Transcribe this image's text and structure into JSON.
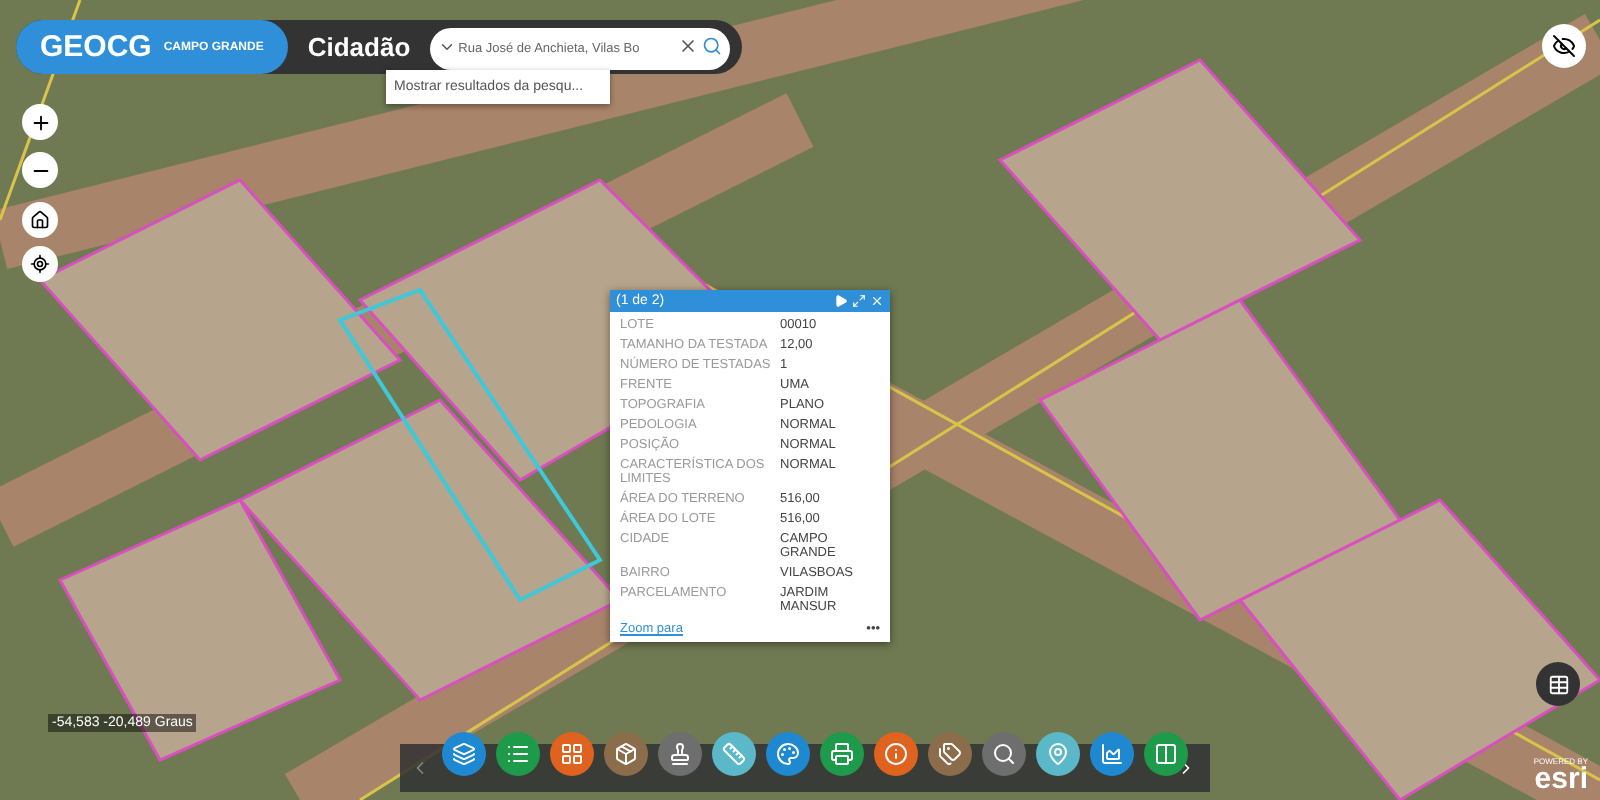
{
  "header": {
    "logo": "GEOCG",
    "city": "CAMPO GRANDE",
    "title": "Cidadão"
  },
  "search": {
    "value": "Rua José de Anchieta, Vilas Bo",
    "suggestion": "Mostrar resultados da pesqu..."
  },
  "popup": {
    "title": "(1 de 2)",
    "rows": [
      {
        "label": "LOTE",
        "value": "00010"
      },
      {
        "label": "TAMANHO DA TESTADA",
        "value": "12,00"
      },
      {
        "label": "NÚMERO DE TESTADAS",
        "value": "1"
      },
      {
        "label": "FRENTE",
        "value": "UMA"
      },
      {
        "label": "TOPOGRAFIA",
        "value": "PLANO"
      },
      {
        "label": "PEDOLOGIA",
        "value": "NORMAL"
      },
      {
        "label": "POSIÇÃO",
        "value": "NORMAL"
      },
      {
        "label": "CARACTERÍSTICA DOS LIMITES",
        "value": "NORMAL"
      },
      {
        "label": "ÁREA DO TERRENO",
        "value": "516,00"
      },
      {
        "label": "ÁREA DO LOTE",
        "value": "516,00"
      },
      {
        "label": "CIDADE",
        "value": "CAMPO GRANDE"
      },
      {
        "label": "BAIRRO",
        "value": "VILASBOAS"
      },
      {
        "label": "PARCELAMENTO",
        "value": "JARDIM MANSUR"
      }
    ],
    "zoom_link": "Zoom para",
    "more": "•••"
  },
  "toolbar": [
    {
      "color": "#1e88d0"
    },
    {
      "color": "#1d9a4a"
    },
    {
      "color": "#e0621f"
    },
    {
      "color": "#8b6d4c"
    },
    {
      "color": "#6e6e6e"
    },
    {
      "color": "#5bb8c8"
    },
    {
      "color": "#1e88d0"
    },
    {
      "color": "#1d9a4a"
    },
    {
      "color": "#e0621f"
    },
    {
      "color": "#8b6d4c"
    },
    {
      "color": "#6e6e6e"
    },
    {
      "color": "#5bb8c8"
    },
    {
      "color": "#1e88d0"
    },
    {
      "color": "#1d9a4a"
    }
  ],
  "coordinates": "-54,583 -20,489 Graus",
  "attribution": {
    "small": "POWERED BY",
    "brand": "esri"
  }
}
